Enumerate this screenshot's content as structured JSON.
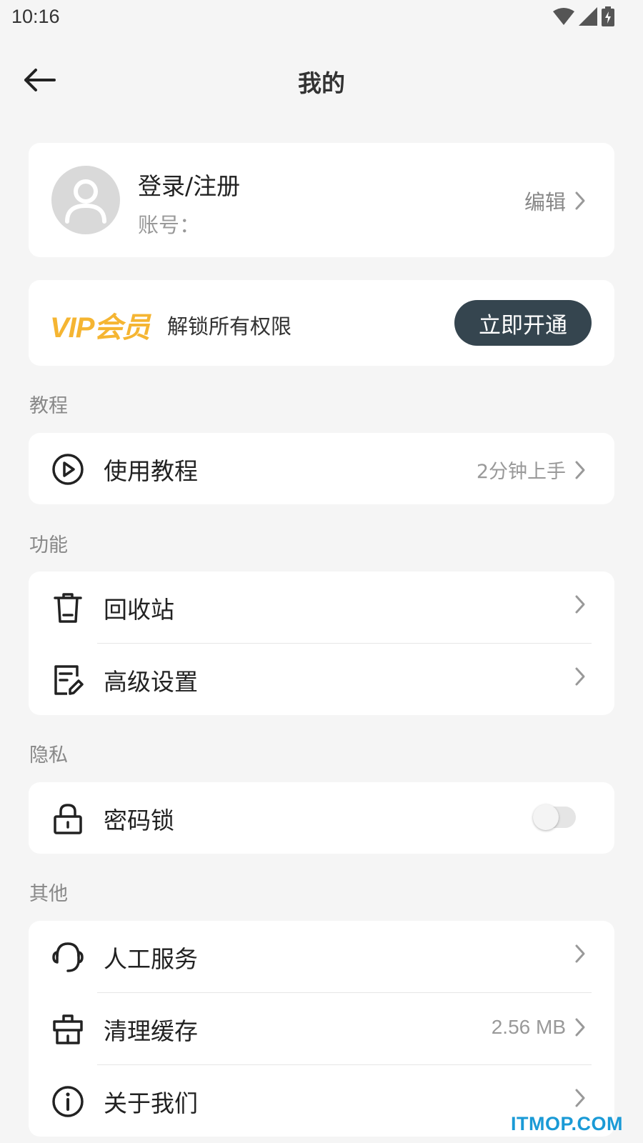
{
  "status_bar": {
    "time": "10:16"
  },
  "header": {
    "title": "我的"
  },
  "profile": {
    "name": "登录/注册",
    "account_label": "账号：",
    "edit_label": "编辑"
  },
  "vip": {
    "logo_text": "VIP会员",
    "description": "解锁所有权限",
    "button_label": "立即开通",
    "logo_color": "#f5b532",
    "button_color": "#35454f"
  },
  "sections": {
    "tutorial": {
      "title": "教程",
      "items": [
        {
          "label": "使用教程",
          "value": "2分钟上手",
          "icon": "play-circle-icon"
        }
      ]
    },
    "features": {
      "title": "功能",
      "items": [
        {
          "label": "回收站",
          "icon": "trash-icon"
        },
        {
          "label": "高级设置",
          "icon": "edit-document-icon"
        }
      ]
    },
    "privacy": {
      "title": "隐私",
      "items": [
        {
          "label": "密码锁",
          "icon": "lock-icon",
          "toggle_on": false
        }
      ]
    },
    "other": {
      "title": "其他",
      "items": [
        {
          "label": "人工服务",
          "icon": "headset-icon"
        },
        {
          "label": "清理缓存",
          "value": "2.56 MB",
          "icon": "broom-icon"
        },
        {
          "label": "关于我们",
          "icon": "info-icon"
        }
      ]
    }
  },
  "watermark": "ITMOP.COM"
}
